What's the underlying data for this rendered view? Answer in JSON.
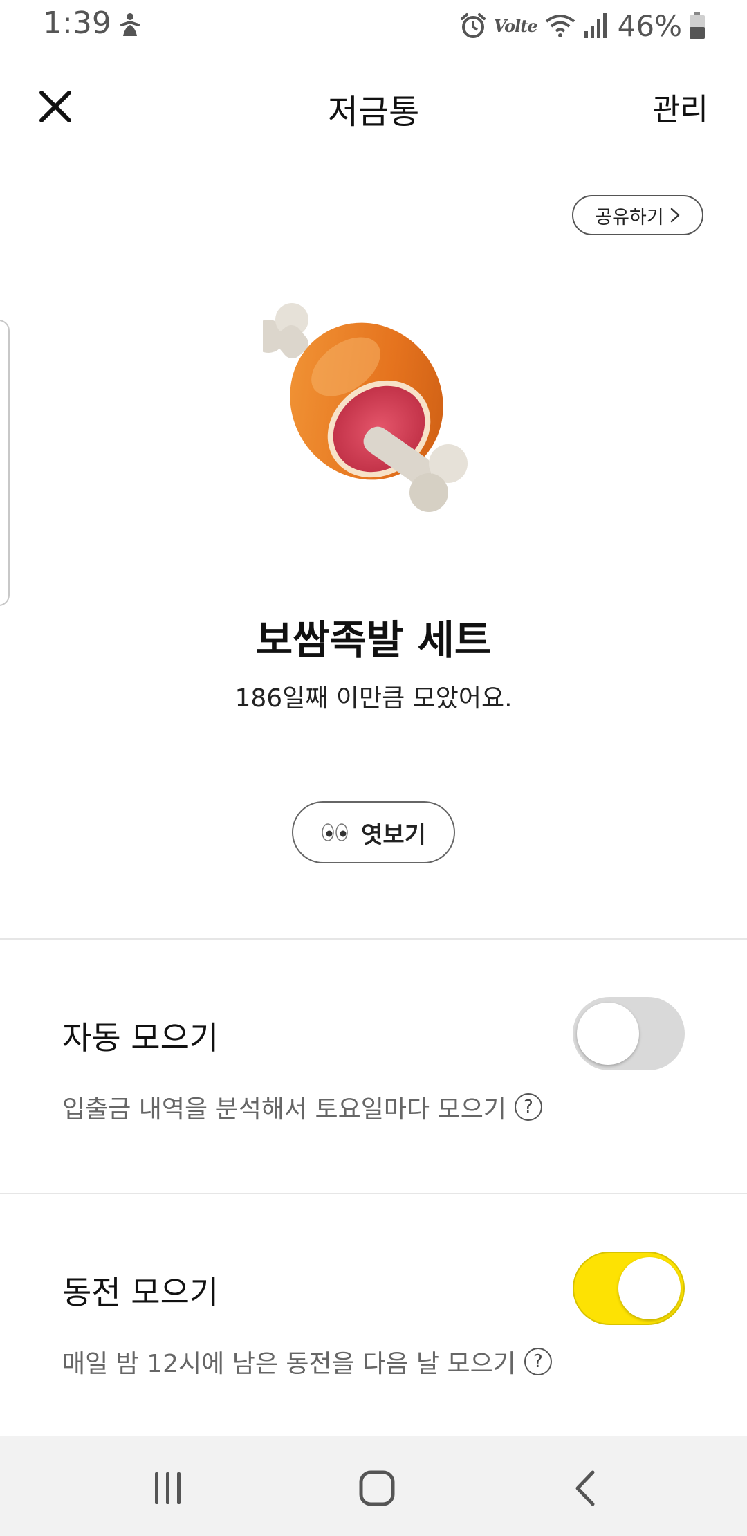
{
  "status_bar": {
    "time": "1:39",
    "network_label": "Volte",
    "battery": "46%"
  },
  "header": {
    "title": "저금통",
    "manage_label": "관리"
  },
  "share": {
    "label": "공유하기"
  },
  "piggy": {
    "name": "보쌈족발 세트",
    "days_text": "186일째 이만큼 모았어요.",
    "peek_label": "엿보기"
  },
  "settings": [
    {
      "title": "자동 모으기",
      "description": "입출금 내역을 분석해서 토요일마다 모으기",
      "enabled": false
    },
    {
      "title": "동전 모으기",
      "description": "매일 밤 12시에 남은 동전을 다음 날 모으기",
      "enabled": true
    }
  ],
  "colors": {
    "toggle_on": "#fde203",
    "toggle_off": "#d9d9d9"
  },
  "icons": {
    "close": "close-icon",
    "share_chevron": "chevron-right-icon",
    "peek": "eyes-icon",
    "help": "help-icon",
    "nav_recent": "recent-apps-icon",
    "nav_home": "home-icon",
    "nav_back": "back-icon"
  }
}
